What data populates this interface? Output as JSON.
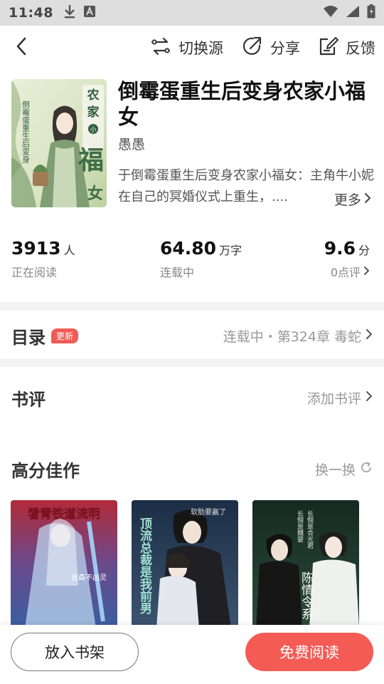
{
  "status_bar": {
    "time": "11:48"
  },
  "top_actions": {
    "switch_source": "切换源",
    "share": "分享",
    "feedback": "反馈"
  },
  "book": {
    "title": "倒霉蛋重生后变身农家小福女",
    "author": "愚愚",
    "description": "于倒霉蛋重生后变身农家小福女：主角牛小妮在自己的冥婚仪式上重生，....",
    "more": "更多",
    "cover_title_text": "倒霉蛋重生后变身农家小福女",
    "cover_side_text": "倒霉蛋重生后变身",
    "cover_chars": {
      "nong": "农",
      "jia": "家",
      "xiao": "小",
      "fu": "福",
      "nv": "女"
    }
  },
  "stats": {
    "readers": {
      "value": "3913",
      "unit": "人",
      "label": "正在阅读"
    },
    "words": {
      "value": "64.80",
      "unit": "万字",
      "label": "连载中"
    },
    "score": {
      "value": "9.6",
      "unit": "分",
      "label": "0点评"
    }
  },
  "catalog": {
    "title": "目录",
    "badge": "更新",
    "status": "连载中・第324章 毒蛇"
  },
  "reviews": {
    "title": "书评",
    "add": "添加书评"
  },
  "recommend": {
    "title": "高分佳作",
    "refresh": "换一换",
    "books": [
      {
        "cover_title": "看青铁道流明",
        "cover_author": "吉森不凶灵"
      },
      {
        "cover_title": "顶流总裁是我前男",
        "cover_author": "软肋要赢了"
      },
      {
        "cover_title": "陈情令系",
        "cover_top": "长惆是合光君",
        "cover_top2": "长惆是魏婴"
      }
    ]
  },
  "bottom": {
    "shelf": "放入书架",
    "read": "免费阅读"
  },
  "colors": {
    "accent": "#f45b55",
    "badge": "#f25a54",
    "status_bar_bg": "#dedede",
    "divider": "#f3f3f3"
  }
}
